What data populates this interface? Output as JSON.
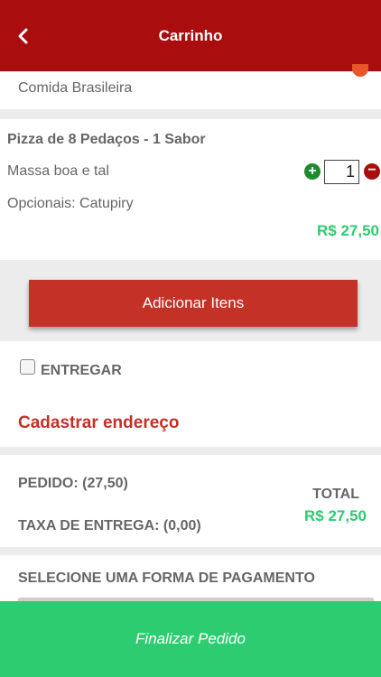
{
  "header": {
    "title": "Carrinho",
    "back_icon": "chevron-left-icon"
  },
  "store": {
    "category": "Comida Brasileira"
  },
  "item": {
    "title": "Pizza de 8 Pedaços - 1 Sabor",
    "description": "Massa boa e tal",
    "options": "Opcionais: Catupiry",
    "price": "R$ 27,50",
    "quantity": "1",
    "plus_symbol": "+",
    "minus_symbol": "−"
  },
  "actions": {
    "add_items": "Adicionar Itens",
    "finish": "Finalizar Pedido"
  },
  "delivery": {
    "checkbox_label": "ENTREGAR",
    "checked": false,
    "register_address": "Cadastrar endereço"
  },
  "totals": {
    "order": "PEDIDO: (27,50)",
    "delivery_fee": "TAXA DE ENTREGA: (0,00)",
    "total_label": "TOTAL",
    "total_value": "R$ 27,50"
  },
  "payment": {
    "label": "SELECIONE UMA FORMA DE PAGAMENTO"
  },
  "colors": {
    "header": "#a90d0d",
    "accent_red": "#c33127",
    "price_green": "#2ecc71",
    "finish_green": "#2ecc71"
  }
}
